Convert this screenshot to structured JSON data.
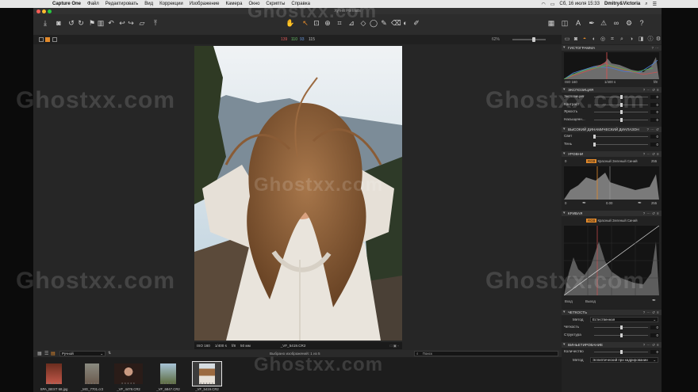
{
  "menubar": {
    "app": "Capture One",
    "items": [
      "Файл",
      "Редактировать",
      "Вид",
      "Коррекции",
      "Изображение",
      "Камера",
      "Окно",
      "Скрипты",
      "Справка"
    ],
    "clock": "Сб, 16 июля 15:33",
    "user": "Dmitry&Victoria"
  },
  "window": {
    "title": "Хутна Portraits"
  },
  "subbar": {
    "r": "139",
    "g": "110",
    "b": "93",
    "a": "115",
    "zoom": "62%"
  },
  "viewer": {
    "info": {
      "iso": "ISO 160",
      "shutter": "1/400 s",
      "aperture": "f/8",
      "focal": "50 мм",
      "filename": "_VF_5419.CR2"
    }
  },
  "browser": {
    "sort": "Ручной",
    "selection_info": "Выбрано изображений: 1 из 5",
    "search_placeholder": "Поиск",
    "thumbnails": [
      {
        "name": "SPA_BEST 68.jpg"
      },
      {
        "name": "_MG_7701.cr2"
      },
      {
        "name": "_VF_4478.CR2"
      },
      {
        "name": "_VF_6847.CR2"
      },
      {
        "name": "_VF_5419.CR2"
      }
    ]
  },
  "panel": {
    "histogram": {
      "title": "ГИСТОГРАММА",
      "iso": "ISO 160",
      "shutter": "1/400 s",
      "aperture": "f/8"
    },
    "exposure": {
      "title": "ЭКСПОЗИЦИЯ",
      "rows": [
        {
          "label": "Экспозиция",
          "value": "0",
          "level": 0.5
        },
        {
          "label": "Контраст",
          "value": "0",
          "level": 0.5
        },
        {
          "label": "Яркость",
          "value": "0",
          "level": 0.5
        },
        {
          "label": "Насыщенн...",
          "value": "0",
          "level": 0.5
        }
      ]
    },
    "hdr": {
      "title": "ВЫСОКИЙ ДИНАМИЧЕСКИЙ ДИАПАЗОН",
      "rows": [
        {
          "label": "Свет",
          "value": "0",
          "level": 0.0
        },
        {
          "label": "Тень",
          "value": "0",
          "level": 0.0
        }
      ]
    },
    "levels": {
      "title": "УРОВНИ",
      "channels": [
        "RGB",
        "Красный",
        "Зеленый",
        "Синий"
      ],
      "low": "0",
      "high": "255",
      "out_low": "0",
      "mid": "0.00",
      "out_high": "255"
    },
    "curve": {
      "title": "КРИВАЯ",
      "channels": [
        "RGB",
        "Красный",
        "Зеленый",
        "Синий"
      ],
      "input_label": "Вход",
      "output_label": "Выход"
    },
    "clarity": {
      "title": "ЧЕТКОСТЬ",
      "method_label": "Метод",
      "method_value": "Естественная",
      "rows": [
        {
          "label": "Четкость",
          "value": "0",
          "level": 0.5
        },
        {
          "label": "Структура",
          "value": "0",
          "level": 0.5
        }
      ]
    },
    "vignette": {
      "title": "ВИНЬЕТИРОВАНИЕ",
      "rows": [
        {
          "label": "Количество",
          "value": "0",
          "level": 0.5
        }
      ],
      "method_label": "Метод",
      "method_value": "Эллиптический при кадрировании"
    }
  },
  "watermark": "Ghostxx.com"
}
